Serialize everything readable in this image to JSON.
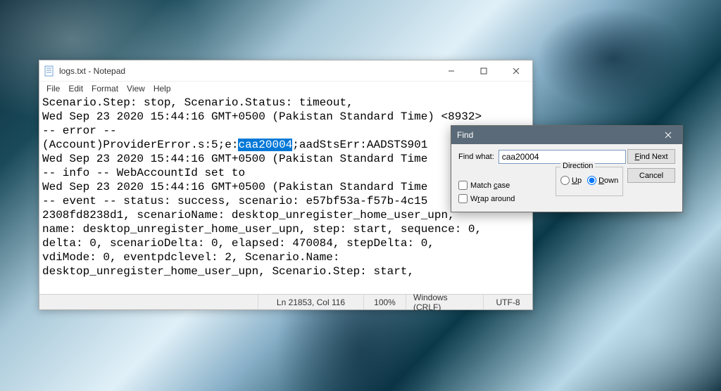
{
  "notepad": {
    "title": "logs.txt - Notepad",
    "menus": [
      "File",
      "Edit",
      "Format",
      "View",
      "Help"
    ],
    "content": {
      "line1": "Scenario.Step: stop, Scenario.Status: timeout,",
      "line2": "Wed Sep 23 2020 15:44:16 GMT+0500 (Pakistan Standard Time) <8932>",
      "line3": "-- error --",
      "line4_pre": "(Account)ProviderError.s:5;e:",
      "line4_hl": "caa20004",
      "line4_post": ";aadStsErr:AADSTS901",
      "line5": "Wed Sep 23 2020 15:44:16 GMT+0500 (Pakistan Standard Time",
      "line6": "-- info -- WebAccountId set to",
      "line7": "Wed Sep 23 2020 15:44:16 GMT+0500 (Pakistan Standard Time",
      "line8": "-- event -- status: success, scenario: e57bf53a-f57b-4c15",
      "line9": "2308fd8238d1, scenarioName: desktop_unregister_home_user_upn,",
      "line10": "name: desktop_unregister_home_user_upn, step: start, sequence: 0,",
      "line11": "delta: 0, scenarioDelta: 0, elapsed: 470084, stepDelta: 0,",
      "line12": "vdiMode: 0, eventpdclevel: 2, Scenario.Name:",
      "line13": "desktop_unregister_home_user_upn, Scenario.Step: start,"
    },
    "status": {
      "position": "Ln 21853, Col 116",
      "zoom": "100%",
      "eol": "Windows (CRLF)",
      "encoding": "UTF-8"
    }
  },
  "find": {
    "title": "Find",
    "label_findwhat": "Find what:",
    "value": "caa20004",
    "btn_findnext": "Find Next",
    "btn_cancel": "Cancel",
    "chk_matchcase_pre": "Match ",
    "chk_matchcase_accel": "c",
    "chk_matchcase_post": "ase",
    "chk_wrap_pre": "W",
    "chk_wrap_accel": "r",
    "chk_wrap_post": "ap around",
    "group_direction": "Direction",
    "radio_up_accel": "U",
    "radio_up_post": "p",
    "radio_down_accel": "D",
    "radio_down_post": "own"
  }
}
